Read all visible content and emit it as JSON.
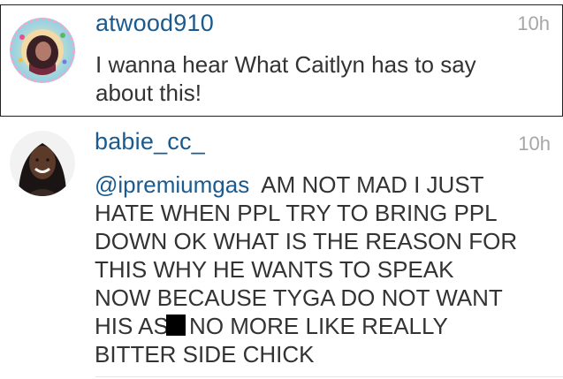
{
  "comments": [
    {
      "username": "atwood910",
      "time": "10h",
      "text_lines": [
        "I wanna hear What Caitlyn has to say",
        "about this!"
      ],
      "avatar_icon": "birthday-frame-avatar"
    },
    {
      "username": "babie_cc_",
      "time": "10h",
      "mention": "@ipremiumgas",
      "line1_rest": "  AM NOT MAD I JUST",
      "text_lines": [
        "HATE WHEN PPL TRY TO BRING PPL",
        "DOWN OK WHAT IS THE REASON FOR",
        "THIS WHY HE WANTS TO SPEAK",
        "NOW BECAUSE TYGA DO NOT WANT"
      ],
      "censored_before": "HIS AS",
      "censored_after": " NO MORE LIKE REALLY",
      "last_line": "BITTER SIDE CHICK",
      "avatar_icon": "woman-portrait-avatar"
    }
  ],
  "colors": {
    "username": "#1a5a8e",
    "mention": "#1a5a8e",
    "time": "#a6a6a6",
    "text": "#333333",
    "highlight_border": "#222222"
  }
}
